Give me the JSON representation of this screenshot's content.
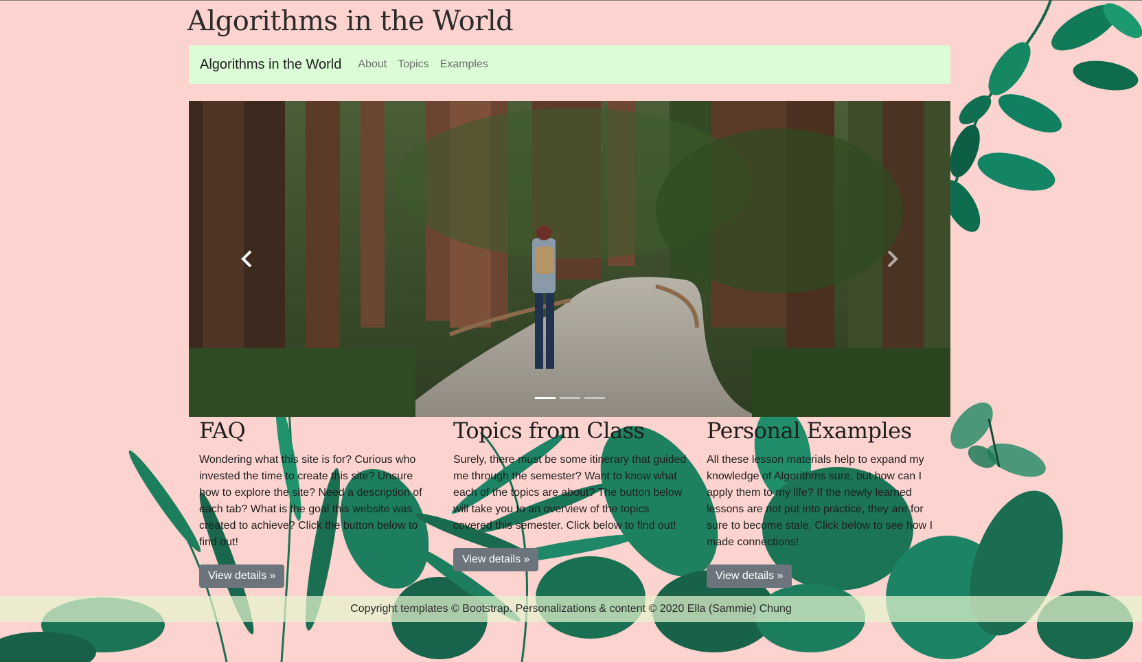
{
  "site_title": "Algorithms in the World",
  "navbar": {
    "brand": "Algorithms in the World",
    "links": [
      "About",
      "Topics",
      "Examples"
    ]
  },
  "carousel": {
    "slide_count": 3,
    "active_index": 0
  },
  "features": [
    {
      "title": "FAQ",
      "text": "Wondering what this site is for? Curious who invested the time to create this site? Unsure how to explore the site? Need a description of each tab? What is the goal this website was created to achieve? Click the button below to find out!",
      "button": "View details »"
    },
    {
      "title": "Topics from Class",
      "text": "Surely, there must be some itinerary that guided me through the semester? Want to know what each of the topics are about? The button below will take you to an overview of the topics covered this semester. Click below to find out!",
      "button": "View details »"
    },
    {
      "title": "Personal Examples",
      "text": "All these lesson materials help to expand my knowledge of Algorithms sure, but how can I apply them to my life? If the newly learned lessons are not put into practice, they are for sure to become stale. Click below to see how I made connections!",
      "button": "View details »"
    }
  ],
  "footer": {
    "text": "Copyright templates © Bootstrap. Personalizations & content © 2020 Ella (Sammie) Chung"
  },
  "colors": {
    "page_background": "#fdd3cf",
    "navbar_background": "#dbfcd6",
    "button_background": "#6c757d",
    "leaf_green": "#0f6b4f"
  }
}
